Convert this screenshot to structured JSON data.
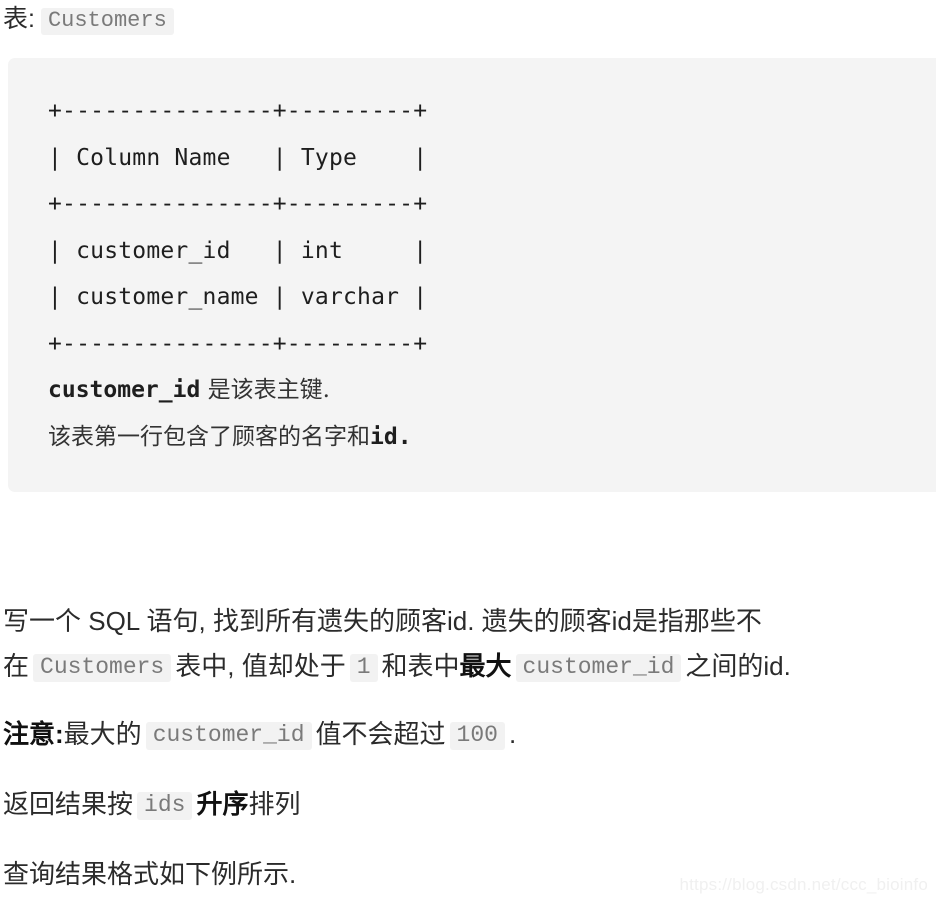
{
  "table_intro": {
    "label": "表:",
    "table_name": "Customers"
  },
  "schema_block": {
    "ascii_table": "+---------------+---------+\n| Column Name   | Type    |\n+---------------+---------+\n| customer_id   | int     |\n| customer_name | varchar |\n+---------------+---------+",
    "rows": [
      {
        "column_name": "Column Name",
        "type": "Type"
      },
      {
        "column_name": "customer_id",
        "type": "int"
      },
      {
        "column_name": "customer_name",
        "type": "varchar"
      }
    ],
    "note_primary_key_code": "customer_id",
    "note_primary_key_text": "是该表主键.",
    "note_second_line": "该表第一行包含了顾客的名字和",
    "note_second_line_code": "id."
  },
  "paragraphs": {
    "main_part1": "写一个 SQL 语句, 找到所有遗失的顾客id. 遗失的顾客id是指那些不",
    "main_line2_prefix": "在",
    "main_line2_code1": "Customers",
    "main_line2_mid1": "表中, 值却处于",
    "main_line2_code2": "1",
    "main_line2_mid2": "和表中",
    "main_line2_bold": "最大",
    "main_line2_code3": "customer_id",
    "main_line2_suffix": "之间的id.",
    "note_bold": "注意:",
    "note_text1": "最大的",
    "note_code1": "customer_id",
    "note_text2": "值不会超过",
    "note_code2": "100",
    "note_text3": ".",
    "order_text1": "返回结果按",
    "order_code": "ids",
    "order_bold": "升序",
    "order_text2": "排列",
    "format_text": "查询结果格式如下例所示."
  },
  "watermark": {
    "url": "https://blog.csdn.net/ccc_bioinfo"
  },
  "colors": {
    "page_background": "#ffffff",
    "code_block_background": "#f4f4f4",
    "inline_code_background": "#f2f2f2",
    "inline_code_text": "#7a7a7a",
    "body_text": "#2b2b2b",
    "watermark_text": "#f0f0f0"
  }
}
